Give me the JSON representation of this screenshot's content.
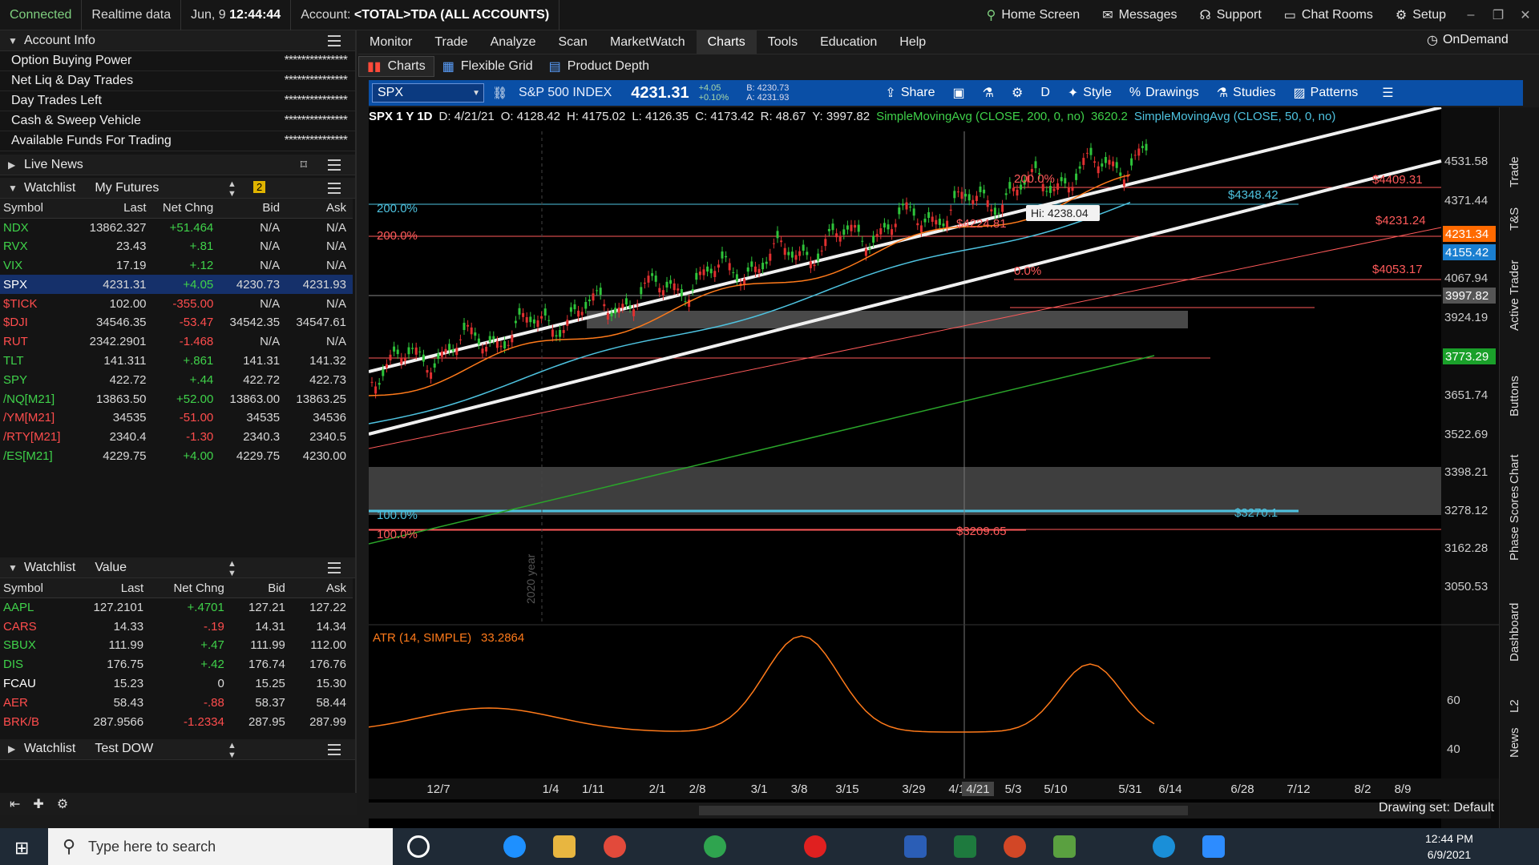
{
  "titlebar": {
    "status": "Connected",
    "data_mode": "Realtime data",
    "date": "Jun, 9",
    "time": "12:44:44",
    "account_label": "Account:",
    "account_value": "<TOTAL>TDA (ALL ACCOUNTS)",
    "home_screen": "Home Screen",
    "messages": "Messages",
    "support": "Support",
    "chat_rooms": "Chat Rooms",
    "setup": "Setup"
  },
  "account_info": {
    "title": "Account Info",
    "rows": [
      {
        "label": "Option Buying Power",
        "value": "***************"
      },
      {
        "label": "Net Liq & Day Trades",
        "value": "***************"
      },
      {
        "label": "Day Trades Left",
        "value": "***************"
      },
      {
        "label": "Cash & Sweep Vehicle",
        "value": "***************"
      },
      {
        "label": "Available Funds For Trading",
        "value": "***************"
      }
    ]
  },
  "live_news": {
    "title": "Live News"
  },
  "watchlist1": {
    "title": "Watchlist",
    "name": "My Futures",
    "badge": "2",
    "headers": [
      "Symbol",
      "Last",
      "Net Chng",
      "Bid",
      "Ask"
    ],
    "rows": [
      {
        "symbol": "NDX",
        "last": "13862.327",
        "chg": "+51.464",
        "bid": "N/A",
        "ask": "N/A",
        "dir": "pos"
      },
      {
        "symbol": "RVX",
        "last": "23.43",
        "chg": "+.81",
        "bid": "N/A",
        "ask": "N/A",
        "dir": "pos"
      },
      {
        "symbol": "VIX",
        "last": "17.19",
        "chg": "+.12",
        "bid": "N/A",
        "ask": "N/A",
        "dir": "pos"
      },
      {
        "symbol": "SPX",
        "last": "4231.31",
        "chg": "+4.05",
        "bid": "4230.73",
        "ask": "4231.93",
        "dir": "pos",
        "selected": true
      },
      {
        "symbol": "$TICK",
        "last": "102.00",
        "chg": "-355.00",
        "bid": "N/A",
        "ask": "N/A",
        "dir": "neg"
      },
      {
        "symbol": "$DJI",
        "last": "34546.35",
        "chg": "-53.47",
        "bid": "34542.35",
        "ask": "34547.61",
        "dir": "neg"
      },
      {
        "symbol": "RUT",
        "last": "2342.2901",
        "chg": "-1.468",
        "bid": "N/A",
        "ask": "N/A",
        "dir": "neg"
      },
      {
        "symbol": "TLT",
        "last": "141.311",
        "chg": "+.861",
        "bid": "141.31",
        "ask": "141.32",
        "dir": "pos"
      },
      {
        "symbol": "SPY",
        "last": "422.72",
        "chg": "+.44",
        "bid": "422.72",
        "ask": "422.73",
        "dir": "pos"
      },
      {
        "symbol": "/NQ[M21]",
        "last": "13863.50",
        "chg": "+52.00",
        "bid": "13863.00",
        "ask": "13863.25",
        "dir": "pos"
      },
      {
        "symbol": "/YM[M21]",
        "last": "34535",
        "chg": "-51.00",
        "bid": "34535",
        "ask": "34536",
        "dir": "neg"
      },
      {
        "symbol": "/RTY[M21]",
        "last": "2340.4",
        "chg": "-1.30",
        "bid": "2340.3",
        "ask": "2340.5",
        "dir": "neg"
      },
      {
        "symbol": "/ES[M21]",
        "last": "4229.75",
        "chg": "+4.00",
        "bid": "4229.75",
        "ask": "4230.00",
        "dir": "pos"
      }
    ]
  },
  "watchlist2": {
    "title": "Watchlist",
    "name": "Value",
    "headers": [
      "Symbol",
      "Last",
      "Net Chng",
      "Bid",
      "Ask"
    ],
    "rows": [
      {
        "symbol": "AAPL",
        "last": "127.2101",
        "chg": "+.4701",
        "bid": "127.21",
        "ask": "127.22",
        "dir": "pos"
      },
      {
        "symbol": "CARS",
        "last": "14.33",
        "chg": "-.19",
        "bid": "14.31",
        "ask": "14.34",
        "dir": "neg"
      },
      {
        "symbol": "SBUX",
        "last": "111.99",
        "chg": "+.47",
        "bid": "111.99",
        "ask": "112.00",
        "dir": "pos"
      },
      {
        "symbol": "DIS",
        "last": "176.75",
        "chg": "+.42",
        "bid": "176.74",
        "ask": "176.76",
        "dir": "pos"
      },
      {
        "symbol": "FCAU",
        "last": "15.23",
        "chg": "0",
        "bid": "15.25",
        "ask": "15.30",
        "dir": "neu"
      },
      {
        "symbol": "AER",
        "last": "58.43",
        "chg": "-.88",
        "bid": "58.37",
        "ask": "58.44",
        "dir": "neg"
      },
      {
        "symbol": "BRK/B",
        "last": "287.9566",
        "chg": "-1.2334",
        "bid": "287.95",
        "ask": "287.99",
        "dir": "neg"
      }
    ]
  },
  "watchlist3": {
    "title": "Watchlist",
    "name": "Test DOW"
  },
  "menu": [
    "Monitor",
    "Trade",
    "Analyze",
    "Scan",
    "MarketWatch",
    "Charts",
    "Tools",
    "Education",
    "Help"
  ],
  "menu_active": "Charts",
  "ondemand": "OnDemand",
  "subtabs": [
    "Charts",
    "Flexible Grid",
    "Product Depth"
  ],
  "symbolbar": {
    "symbol": "SPX",
    "name": "S&P 500 INDEX",
    "price": "4231.31",
    "chg": "+4.05",
    "chg_pct": "+0.10%",
    "bid": "B: 4230.73",
    "ask": "A: 4231.93",
    "share": "Share",
    "period": "D",
    "style": "Style",
    "drawings": "Drawings",
    "studies": "Studies",
    "patterns": "Patterns"
  },
  "infobar": {
    "title": "SPX 1 Y 1D",
    "d": "D: 4/21/21",
    "o": "O: 4128.42",
    "h": "H: 4175.02",
    "l": "L: 4126.35",
    "c": "C: 4173.42",
    "r": "R: 48.67",
    "y": "Y: 3997.82",
    "sma200": "SimpleMovingAvg (CLOSE, 200, 0, no)",
    "sma200_val": "3620.2",
    "sma50": "SimpleMovingAvg (CLOSE, 50, 0, no)"
  },
  "chart_data": {
    "type": "candlestick",
    "y_ticks": [
      "4531.58",
      "4371.44",
      "4067.94",
      "3924.19",
      "3651.74",
      "3522.69",
      "3398.21",
      "3278.12",
      "3162.28",
      "3050.53"
    ],
    "x_ticks": [
      "12/7",
      "1/4",
      "1/11",
      "2/1",
      "2/8",
      "3/1",
      "3/8",
      "3/15",
      "3/29",
      "4/12",
      "4/21",
      "5/3",
      "5/10",
      "5/31",
      "6/14",
      "6/28",
      "7/12",
      "8/2",
      "8/9"
    ],
    "ylim": [
      3000,
      4600
    ],
    "price_tags": [
      {
        "text": "4231.34",
        "color": "#ff6a00"
      },
      {
        "text": "4155.42",
        "color": "#1a7fd0"
      },
      {
        "text": "3997.82",
        "color": "#555"
      },
      {
        "text": "3773.29",
        "color": "#1aa02a"
      }
    ],
    "fib_labels": [
      {
        "text": "200.0%",
        "color": "#4ec3e0"
      },
      {
        "text": "200.0%",
        "color": "#ff5a5a"
      },
      {
        "text": "100.0%",
        "color": "#4ec3e0"
      },
      {
        "text": "100.0%",
        "color": "#ff5a5a"
      },
      {
        "text": "200.0%",
        "color": "#ff5a5a"
      },
      {
        "text": "0.0%",
        "color": "#ff5a5a"
      }
    ],
    "level_labels": [
      {
        "text": "$4409.31",
        "color": "#ff5a5a"
      },
      {
        "text": "$4348.42",
        "color": "#4ec3e0"
      },
      {
        "text": "$4231.24",
        "color": "#ff5a5a"
      },
      {
        "text": "$4053.17",
        "color": "#ff5a5a"
      },
      {
        "text": "$4224.81",
        "color": "#ff5a5a"
      },
      {
        "text": "$3270.1",
        "color": "#4ec3e0"
      },
      {
        "text": "$3209.65",
        "color": "#ff5a5a"
      }
    ],
    "hi_label": "Hi: 4238.04",
    "year_label": "2020 year",
    "cursor_x_label": "4/21"
  },
  "atr": {
    "label": "ATR (14, SIMPLE)",
    "value": "33.2864",
    "y_ticks": [
      "60",
      "40"
    ]
  },
  "bottom": {
    "drawing_set": "Drawing set: Default"
  },
  "right_tabs": [
    "Trade",
    "T&S",
    "Active Trader",
    "Buttons",
    "Chart",
    "Phase Scores",
    "Dashboard",
    "L2",
    "News"
  ],
  "taskbar": {
    "search_placeholder": "Type here to search",
    "time": "12:44 PM",
    "date": "6/9/2021"
  }
}
